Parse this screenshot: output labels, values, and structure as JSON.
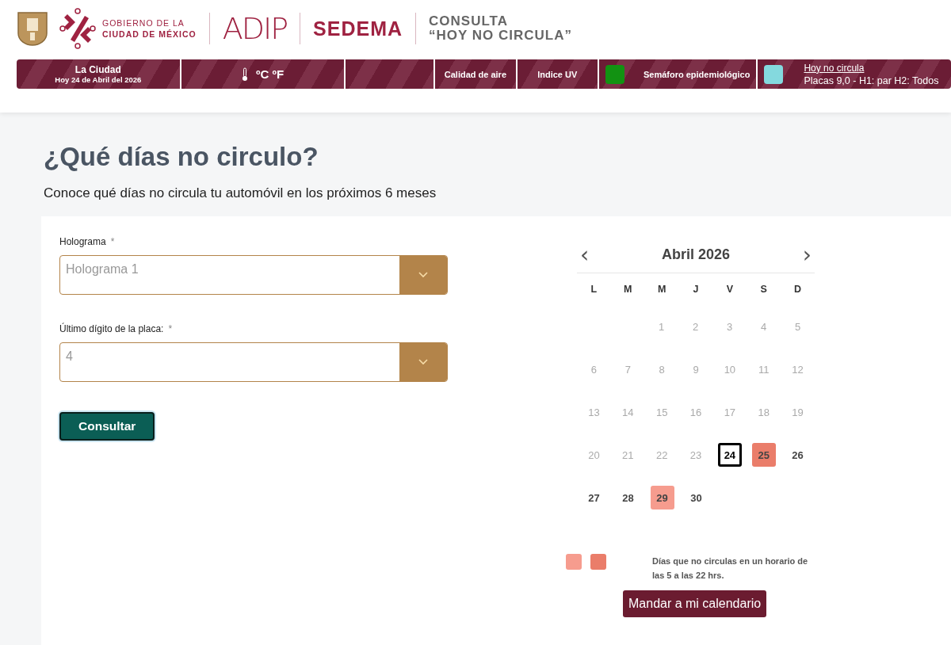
{
  "header": {
    "government": [
      "GOBIERNO DE LA",
      "CIUDAD DE MÉXICO"
    ],
    "agency_logo": "ADIP",
    "agency": "SEDEMA",
    "title": [
      "CONSULTA",
      "“HOY NO CIRCULA”"
    ]
  },
  "info_bar": [
    {
      "kind": "city",
      "title": "La Ciudad",
      "subtitle": "Hoy 24 de Abril del 2026"
    },
    {
      "kind": "weather",
      "text": "ºC ºF"
    },
    {
      "kind": "empty"
    },
    {
      "kind": "label",
      "text": "Calidad de aire"
    },
    {
      "kind": "label",
      "text": "Indice UV"
    },
    {
      "kind": "status",
      "color": "#129212",
      "text": "Semáforo epidemiológico"
    },
    {
      "kind": "link",
      "color": "#84d9de",
      "link": "Hoy no circula",
      "text": "Placas 9,0 - H1: par H2: Todos"
    }
  ],
  "page": {
    "title": "¿Qué días no circulo?",
    "subtitle": "Conoce qué días no circula tu automóvil en los próximos 6 meses"
  },
  "form": {
    "fields": [
      {
        "label": "Holograma",
        "required": "*",
        "value": "Holograma 1"
      },
      {
        "label": "Último dígito de la placa:",
        "required": "*",
        "value": "4"
      }
    ],
    "submit": "Consultar"
  },
  "calendar": {
    "month": "Abril 2026",
    "prev": "‹",
    "next": "›",
    "weekdays": [
      "L",
      "M",
      "M",
      "J",
      "V",
      "S",
      "D"
    ],
    "weeks": [
      {
        "kind": "leading",
        "days": [
          {
            "label": "1",
            "past": true
          },
          {
            "label": "2",
            "past": true
          },
          {
            "label": "3",
            "past": true
          },
          {
            "label": "4",
            "past": true
          },
          {
            "label": "5",
            "past": true
          }
        ]
      },
      {
        "kind": "full",
        "days": [
          {
            "label": "6",
            "past": true
          },
          {
            "label": "7",
            "past": true
          },
          {
            "label": "8",
            "past": true
          },
          {
            "label": "9",
            "past": true
          },
          {
            "label": "10",
            "past": true
          },
          {
            "label": "11",
            "past": true
          },
          {
            "label": "12",
            "past": true
          }
        ]
      },
      {
        "kind": "full",
        "days": [
          {
            "label": "13",
            "past": true
          },
          {
            "label": "14",
            "past": true
          },
          {
            "label": "15",
            "past": true
          },
          {
            "label": "16",
            "past": true
          },
          {
            "label": "17",
            "past": true
          },
          {
            "label": "18",
            "past": true
          },
          {
            "label": "19",
            "past": true
          }
        ]
      },
      {
        "kind": "full",
        "days": [
          {
            "label": "20",
            "past": true
          },
          {
            "label": "21",
            "past": true
          },
          {
            "label": "22",
            "past": true
          },
          {
            "label": "23",
            "past": true
          },
          {
            "label": "24",
            "past": false,
            "today": true
          },
          {
            "label": "25",
            "past": false,
            "color": "#ea7d6a"
          },
          {
            "label": "26",
            "past": false
          }
        ]
      },
      {
        "kind": "trailing",
        "days": [
          {
            "label": "27",
            "past": false
          },
          {
            "label": "28",
            "past": false
          },
          {
            "label": "29",
            "past": false,
            "color": "#f69c8e"
          },
          {
            "label": "30",
            "past": false
          }
        ]
      }
    ],
    "legend": {
      "swatches": [
        {
          "color": "#f69c8e"
        },
        {
          "color": "#ea7d6a"
        }
      ],
      "text": "Días que no circulas en un horario de las 5 a las 22 hrs."
    },
    "export_button": "Mandar a mi calendario"
  }
}
